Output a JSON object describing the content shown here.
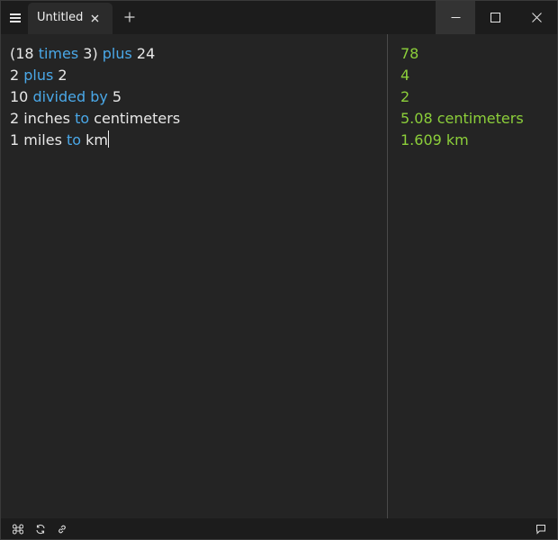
{
  "app": {
    "tab_title": "Untitled"
  },
  "icons": {
    "menu": "hamburger-icon",
    "tab_close": "close-icon",
    "new_tab": "plus-icon",
    "minimize": "minimize-icon",
    "maximize": "maximize-icon",
    "close": "close-icon",
    "command": "command-icon",
    "sync": "sync-icon",
    "link": "link-icon",
    "comment": "comment-icon"
  },
  "colors": {
    "keyword": "#4aa8e8",
    "result": "#8ccf3a",
    "text": "#e8e8e8",
    "background": "#242424"
  },
  "editor": {
    "lines": [
      {
        "tokens": [
          {
            "t": "(18 ",
            "kw": false
          },
          {
            "t": "times",
            "kw": true
          },
          {
            "t": " 3) ",
            "kw": false
          },
          {
            "t": "plus",
            "kw": true
          },
          {
            "t": " 24",
            "kw": false
          }
        ]
      },
      {
        "tokens": [
          {
            "t": "2 ",
            "kw": false
          },
          {
            "t": "plus",
            "kw": true
          },
          {
            "t": " 2",
            "kw": false
          }
        ]
      },
      {
        "tokens": [
          {
            "t": "10 ",
            "kw": false
          },
          {
            "t": "divided",
            "kw": true
          },
          {
            "t": " ",
            "kw": false
          },
          {
            "t": "by",
            "kw": true
          },
          {
            "t": " 5",
            "kw": false
          }
        ]
      },
      {
        "tokens": [
          {
            "t": "2 inches ",
            "kw": false
          },
          {
            "t": "to",
            "kw": true
          },
          {
            "t": " centimeters",
            "kw": false
          }
        ]
      },
      {
        "tokens": [
          {
            "t": "1 miles ",
            "kw": false
          },
          {
            "t": "to",
            "kw": true
          },
          {
            "t": " km",
            "kw": false
          }
        ]
      }
    ]
  },
  "results": [
    "78",
    "4",
    "2",
    "5.08 centimeters",
    "1.609 km"
  ]
}
